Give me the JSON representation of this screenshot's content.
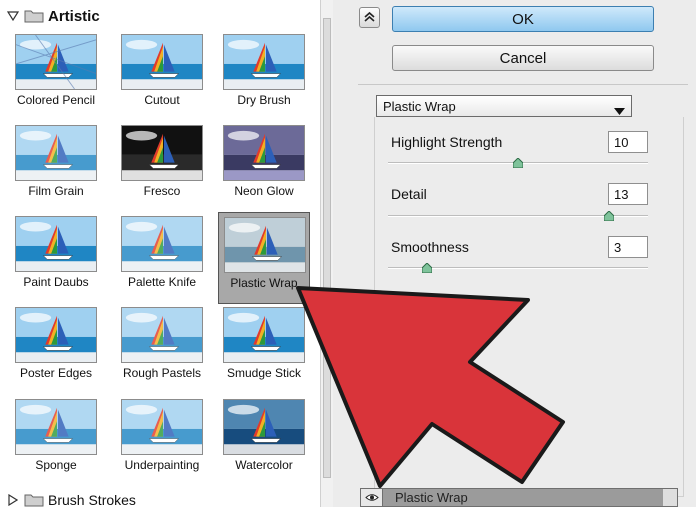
{
  "gallery": {
    "folders": [
      {
        "label": "Artistic",
        "expanded": true
      },
      {
        "label": "Brush Strokes",
        "expanded": false
      }
    ],
    "filters": [
      {
        "label": "Colored Pencil",
        "style": "pencil"
      },
      {
        "label": "Cutout",
        "style": "cutout"
      },
      {
        "label": "Dry Brush",
        "style": "normal"
      },
      {
        "label": "Film Grain",
        "style": "grain"
      },
      {
        "label": "Fresco",
        "style": "fresco"
      },
      {
        "label": "Neon Glow",
        "style": "neon"
      },
      {
        "label": "Paint Daubs",
        "style": "normal"
      },
      {
        "label": "Palette Knife",
        "style": "blur"
      },
      {
        "label": "Plastic Wrap",
        "style": "plastic",
        "selected": true
      },
      {
        "label": "Poster Edges",
        "style": "normal"
      },
      {
        "label": "Rough Pastels",
        "style": "grain"
      },
      {
        "label": "Smudge Stick",
        "style": "normal"
      },
      {
        "label": "Sponge",
        "style": "blur"
      },
      {
        "label": "Underpainting",
        "style": "blur"
      },
      {
        "label": "Watercolor",
        "style": "dark"
      }
    ]
  },
  "settings": {
    "ok_label": "OK",
    "cancel_label": "Cancel",
    "filter_selected": "Plastic Wrap",
    "params": [
      {
        "label": "Highlight Strength",
        "value": "10",
        "fraction": 0.5
      },
      {
        "label": "Detail",
        "value": "13",
        "fraction": 0.85
      },
      {
        "label": "Smoothness",
        "value": "3",
        "fraction": 0.15
      }
    ],
    "layer_name": "Plastic Wrap"
  },
  "colors": {
    "ok_button": "#8fc8ef",
    "selected_tile": "#a8a8a8",
    "arrow": "#d9343a"
  },
  "icons": [
    "chevron-down-icon",
    "chevron-right-icon",
    "folder-icon",
    "collapse-up-icon",
    "dropdown-arrow-icon",
    "slider-knob-icon",
    "eye-icon"
  ]
}
